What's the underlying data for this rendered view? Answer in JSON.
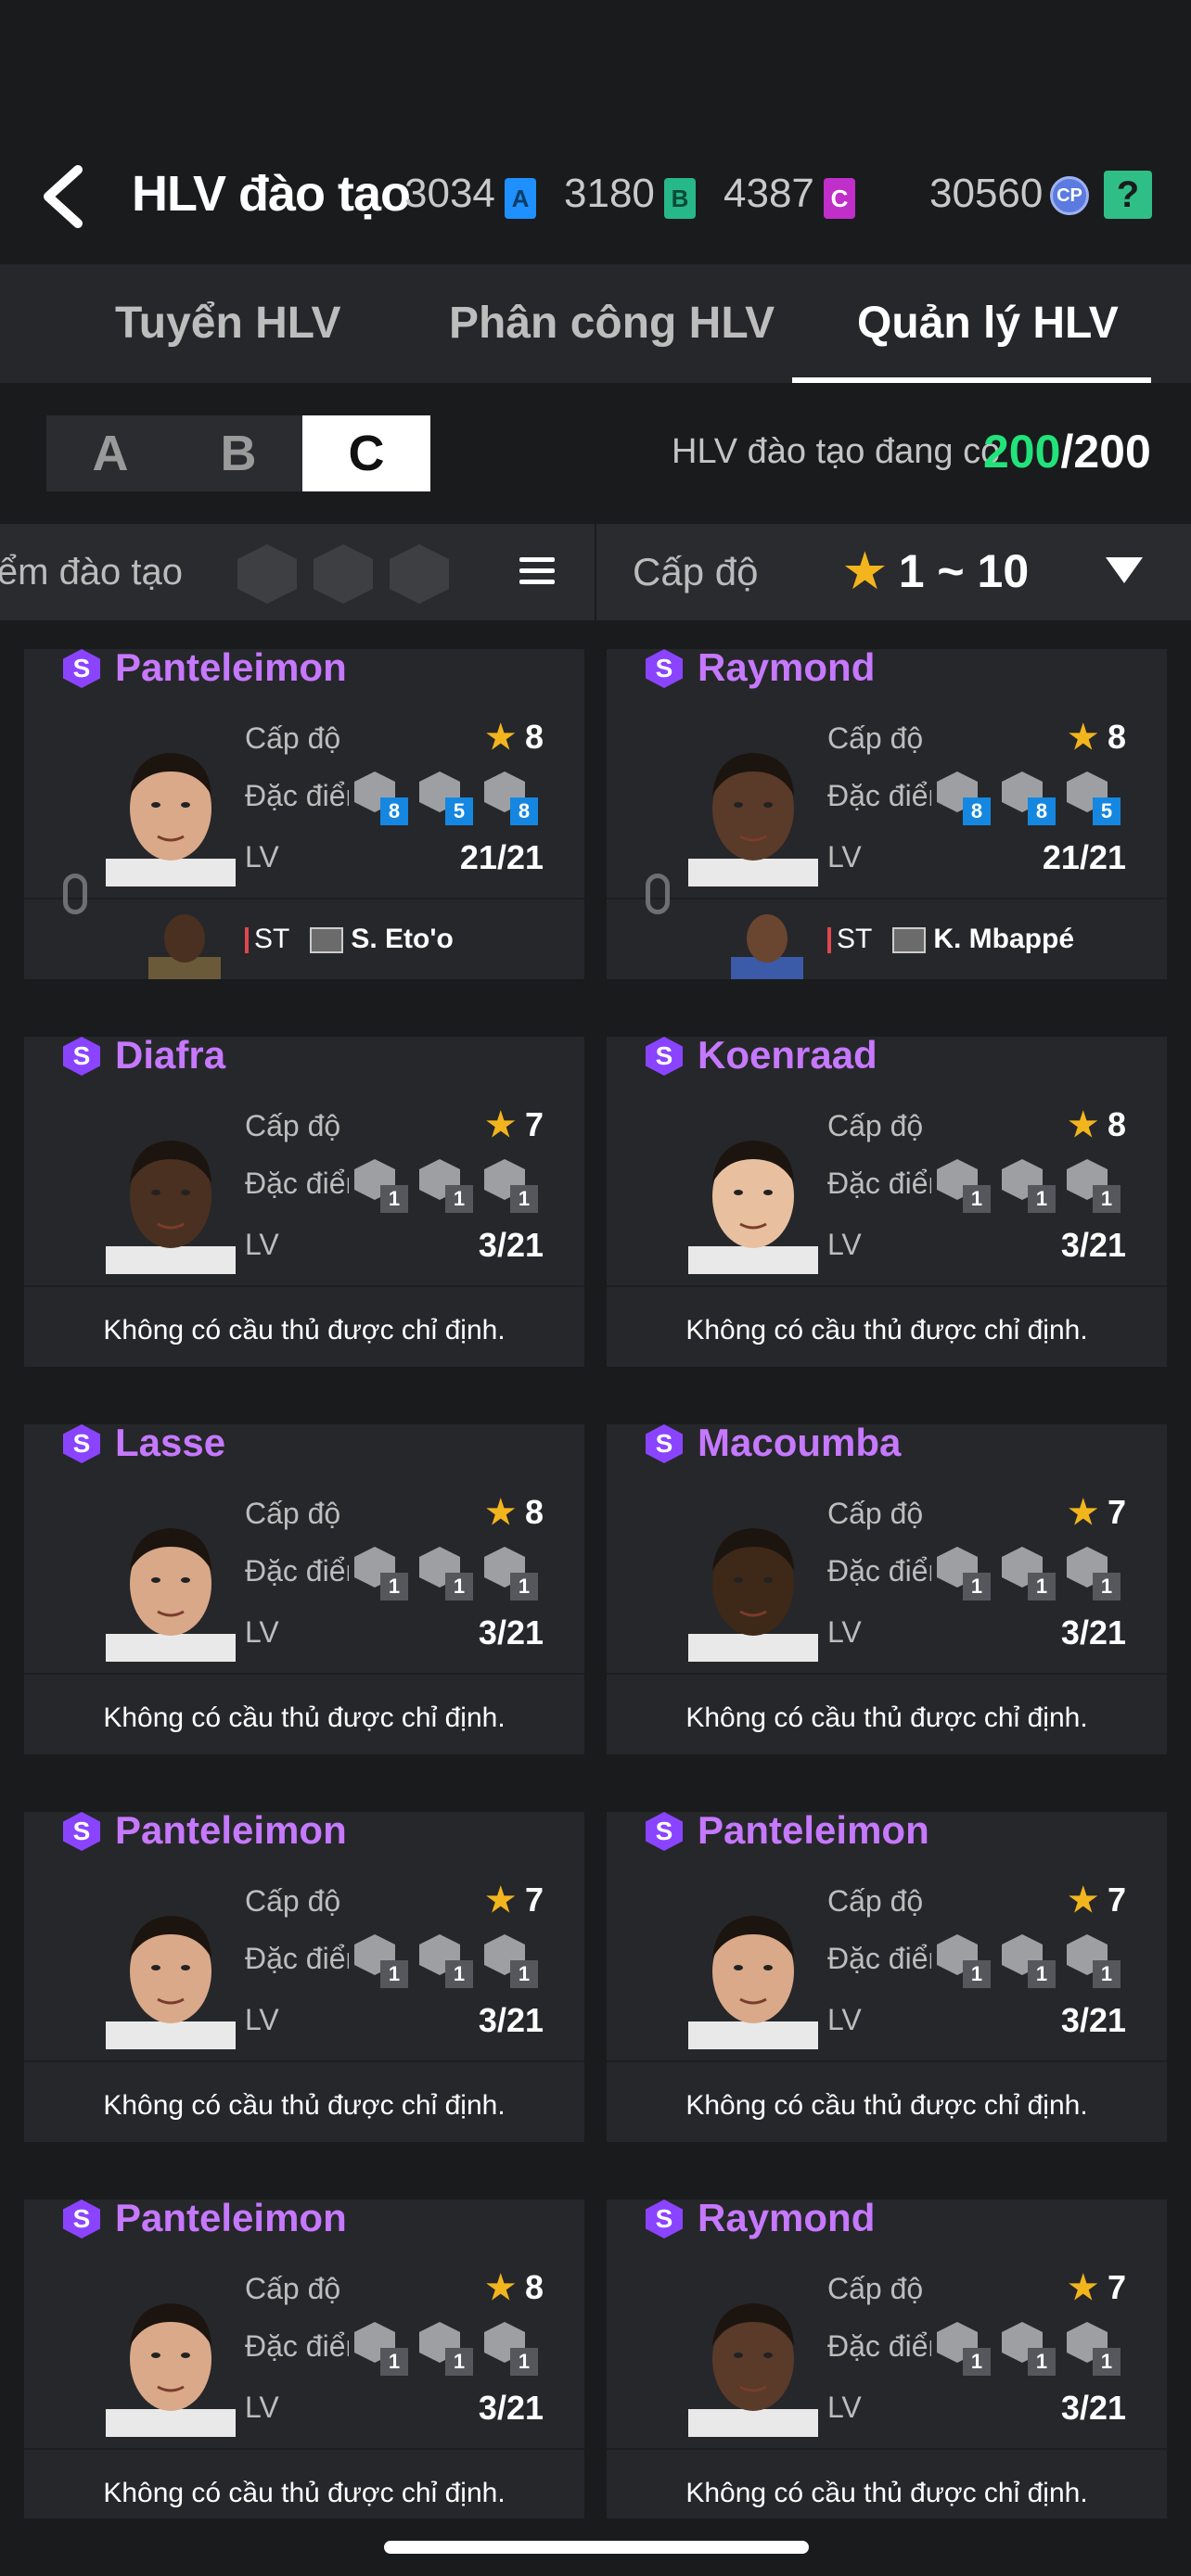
{
  "header": {
    "title": "HLV đào tạo",
    "currencies": [
      {
        "value": "3034",
        "ticket": "A",
        "color": "#1e90ff"
      },
      {
        "value": "3180",
        "ticket": "B",
        "color": "#27b88a"
      },
      {
        "value": "4387",
        "ticket": "C",
        "color": "#c02fc9"
      }
    ],
    "cp_value": "30560",
    "cp_label": "CP",
    "help": "?"
  },
  "tabs": [
    {
      "label": "Tuyển HLV",
      "active": false
    },
    {
      "label": "Phân công HLV",
      "active": false
    },
    {
      "label": "Quản lý HLV",
      "active": true
    }
  ],
  "segments": [
    "A",
    "B",
    "C"
  ],
  "active_segment": "C",
  "coach_count": {
    "label": "HLV đào tạo đang có",
    "current": "200",
    "max": "/200"
  },
  "filter": {
    "trait_label": "iểm đào tạo",
    "level_label": "Cấp độ",
    "level_star": "★",
    "level_range": "1 ~ 10"
  },
  "labels": {
    "level": "Cấp độ",
    "trait": "Đặc điểm",
    "lv": "LV",
    "no_player": "Không có cầu thủ được chỉ định."
  },
  "coaches": [
    {
      "name": "Panteleimon",
      "badge": "S",
      "level": "8",
      "traits": [
        "8",
        "5",
        "8"
      ],
      "trait_color": "blue",
      "lv": "21/21",
      "assigned": {
        "pos": "ST",
        "player": "S. Eto'o"
      },
      "skin": "#d9a98a"
    },
    {
      "name": "Raymond",
      "badge": "S",
      "level": "8",
      "traits": [
        "8",
        "8",
        "5"
      ],
      "trait_color": "blue",
      "lv": "21/21",
      "assigned": {
        "pos": "ST",
        "player": "K. Mbappé"
      },
      "skin": "#5a3a28"
    },
    {
      "name": "Diafra",
      "badge": "S",
      "level": "7",
      "traits": [
        "1",
        "1",
        "1"
      ],
      "trait_color": "gray",
      "lv": "3/21",
      "assigned": null,
      "skin": "#4a3020"
    },
    {
      "name": "Koenraad",
      "badge": "S",
      "level": "8",
      "traits": [
        "1",
        "1",
        "1"
      ],
      "trait_color": "gray",
      "lv": "3/21",
      "assigned": null,
      "skin": "#e8c0a0"
    },
    {
      "name": "Lasse",
      "badge": "S",
      "level": "8",
      "traits": [
        "1",
        "1",
        "1"
      ],
      "trait_color": "gray",
      "lv": "3/21",
      "assigned": null,
      "skin": "#d8a888"
    },
    {
      "name": "Macoumba",
      "badge": "S",
      "level": "7",
      "traits": [
        "1",
        "1",
        "1"
      ],
      "trait_color": "gray",
      "lv": "3/21",
      "assigned": null,
      "skin": "#3e2818"
    },
    {
      "name": "Panteleimon",
      "badge": "S",
      "level": "7",
      "traits": [
        "1",
        "1",
        "1"
      ],
      "trait_color": "gray",
      "lv": "3/21",
      "assigned": null,
      "skin": "#d9a98a"
    },
    {
      "name": "Panteleimon",
      "badge": "S",
      "level": "7",
      "traits": [
        "1",
        "1",
        "1"
      ],
      "trait_color": "gray",
      "lv": "3/21",
      "assigned": null,
      "skin": "#d9a98a"
    },
    {
      "name": "Panteleimon",
      "badge": "S",
      "level": "8",
      "traits": [
        "1",
        "1",
        "1"
      ],
      "trait_color": "gray",
      "lv": "3/21",
      "assigned": null,
      "skin": "#d9a98a"
    },
    {
      "name": "Raymond",
      "badge": "S",
      "level": "7",
      "traits": [
        "1",
        "1",
        "1"
      ],
      "trait_color": "gray",
      "lv": "3/21",
      "assigned": null,
      "skin": "#5a3a28"
    }
  ]
}
